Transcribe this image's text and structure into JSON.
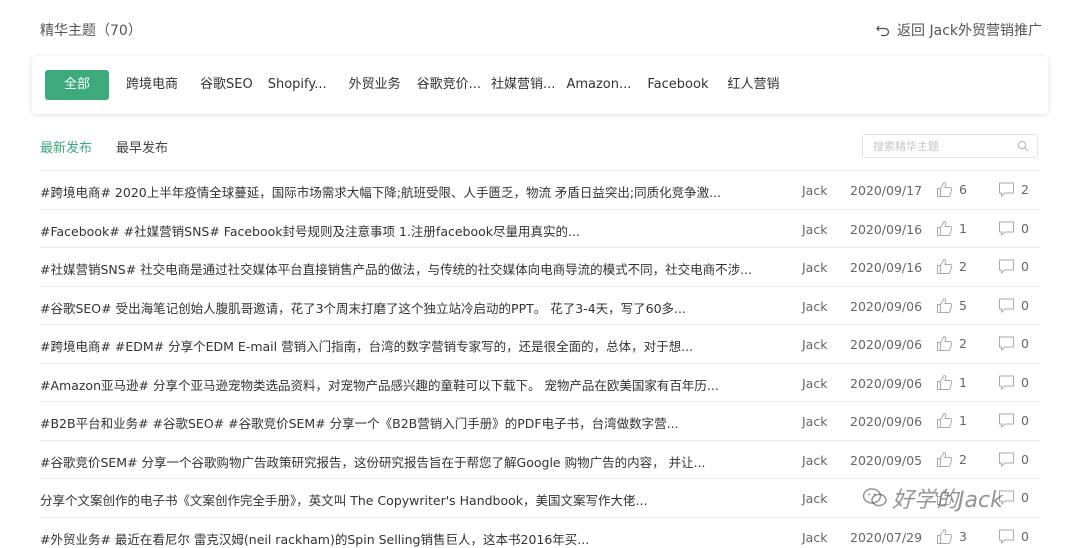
{
  "header": {
    "title": "精华主题（70）",
    "back_label": "返回 Jack外贸营销推广"
  },
  "categories": {
    "items": [
      {
        "label": "全部",
        "active": true
      },
      {
        "label": "跨境电商"
      },
      {
        "label": "谷歌SEO"
      },
      {
        "label": "Shopify..."
      },
      {
        "label": "外贸业务"
      },
      {
        "label": "谷歌竞价..."
      },
      {
        "label": "社媒营销..."
      },
      {
        "label": "Amazon..."
      },
      {
        "label": "Facebook"
      },
      {
        "label": "红人营销"
      }
    ]
  },
  "sort": {
    "newest": "最新发布",
    "oldest": "最早发布",
    "active": "newest"
  },
  "search": {
    "placeholder": "搜索精华主题"
  },
  "topics": [
    {
      "title": "#跨境电商# 2020上半年疫情全球蔓延，国际市场需求大幅下降;航班受限、人手匮乏，物流 矛盾日益突出;同质化竞争激...",
      "author": "Jack",
      "date": "2020/09/17",
      "likes": "6",
      "comments": "2"
    },
    {
      "title": "#Facebook# #社媒营销SNS# Facebook封号规则及注意事项 1.注册facebook尽量用真实的...",
      "author": "Jack",
      "date": "2020/09/16",
      "likes": "1",
      "comments": "0"
    },
    {
      "title": "#社媒营销SNS# 社交电商是通过社交媒体平台直接销售产品的做法，与传统的社交媒体向电商导流的模式不同，社交电商不涉...",
      "author": "Jack",
      "date": "2020/09/16",
      "likes": "2",
      "comments": "0"
    },
    {
      "title": "#谷歌SEO# 受出海笔记创始人腹肌哥邀请，花了3个周末打磨了这个独立站冷启动的PPT。 花了3-4天，写了60多...",
      "author": "Jack",
      "date": "2020/09/06",
      "likes": "5",
      "comments": "0"
    },
    {
      "title": "#跨境电商# #EDM# 分享个EDM E-mail 营销入门指南，台湾的数字营销专家写的，还是很全面的，总体，对于想...",
      "author": "Jack",
      "date": "2020/09/06",
      "likes": "2",
      "comments": "0"
    },
    {
      "title": "#Amazon亚马逊# 分享个亚马逊宠物类选品资料，对宠物产品感兴趣的童鞋可以下载下。 宠物产品在欧美国家有百年历...",
      "author": "Jack",
      "date": "2020/09/06",
      "likes": "1",
      "comments": "0"
    },
    {
      "title": "#B2B平台和业务# #谷歌SEO# #谷歌竞价SEM# 分享一个《B2B营销入门手册》的PDF电子书，台湾做数字营...",
      "author": "Jack",
      "date": "2020/09/06",
      "likes": "1",
      "comments": "0"
    },
    {
      "title": "#谷歌竞价SEM# 分享一个谷歌购物广告政策研究报告，这份研究报告旨在于帮您了解Google 购物广告的内容， 并让...",
      "author": "Jack",
      "date": "2020/09/05",
      "likes": "2",
      "comments": "0"
    },
    {
      "title": "分享个文案创作的电子书《文案创作完全手册》，英文叫 The Copywriter's Handbook，美国文案写作大佬...",
      "author": "Jack",
      "date": "",
      "likes": "",
      "comments": "0"
    },
    {
      "title": "#外贸业务# 最近在看尼尔 雷克汉姆(neil rackham)的Spin Selling销售巨人，这本书2016年买...",
      "author": "Jack",
      "date": "2020/07/29",
      "likes": "3",
      "comments": "0"
    }
  ],
  "watermark": {
    "text": "好学的Jack"
  },
  "colors": {
    "accent": "#3daa7e",
    "text": "#333333",
    "muted": "#666666"
  }
}
